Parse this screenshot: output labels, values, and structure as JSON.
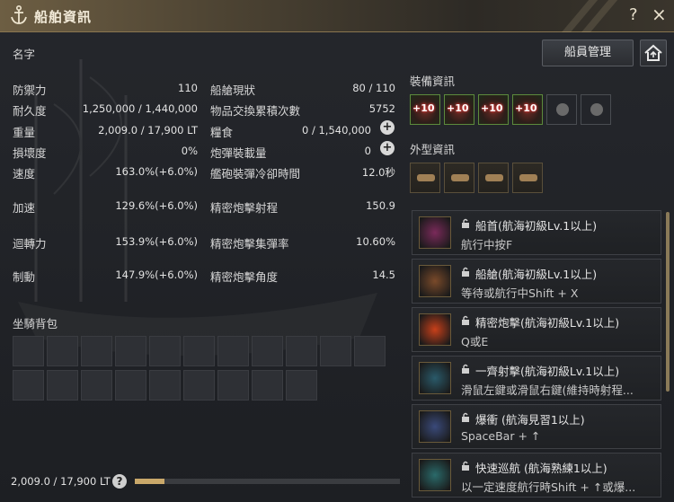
{
  "window": {
    "title": "船舶資訊",
    "help": "?",
    "close": "×"
  },
  "ship_name_label": "名字",
  "stats_left": [
    {
      "label": "防禦力",
      "value": "110"
    },
    {
      "label": "耐久度",
      "value": "1,250,000 / 1,440,000"
    },
    {
      "label": "重量",
      "value": "2,009.0 / 17,900 LT"
    },
    {
      "label": "損壞度",
      "value": "0%"
    },
    {
      "label": "速度",
      "value": "163.0%(+6.0%)"
    },
    {
      "label": "加速",
      "value": "129.6%(+6.0%)"
    },
    {
      "label": "迴轉力",
      "value": "153.9%(+6.0%)"
    },
    {
      "label": "制動",
      "value": "147.9%(+6.0%)"
    }
  ],
  "stats_right": [
    {
      "label": "船艙現狀",
      "value": "80 / 110"
    },
    {
      "label": "物品交換累積次數",
      "value": "5752"
    },
    {
      "label": "糧食",
      "value": "0 / 1,540,000"
    },
    {
      "label": "炮彈裝載量",
      "value": "0"
    },
    {
      "label": "艦砲裝彈冷卻時間",
      "value": "12.0秒"
    },
    {
      "label": "精密炮擊射程",
      "value": "150.9"
    },
    {
      "label": "精密炮擊集彈率",
      "value": "10.60%"
    },
    {
      "label": "精密炮擊角度",
      "value": "14.5"
    }
  ],
  "crew_button": "船員管理",
  "equipment": {
    "title": "裝備資訊",
    "slots": [
      {
        "enhance": "+10",
        "icon": "ship-prow-icon"
      },
      {
        "enhance": "+10",
        "icon": "ship-plating-icon"
      },
      {
        "enhance": "+10",
        "icon": "ship-cannon-icon"
      },
      {
        "enhance": "+10",
        "icon": "ship-sail-icon"
      },
      {
        "enhance": "",
        "icon": "crew-emblem-icon"
      },
      {
        "enhance": "",
        "icon": "fishing-rod-icon"
      }
    ]
  },
  "appearance": {
    "title": "外型資訊",
    "slots": 4
  },
  "skills": [
    {
      "name": "船首(航海初級Lv.1以上)",
      "desc": "航行中按F",
      "color": "#7a2a5a"
    },
    {
      "name": "船艙(航海初級Lv.1以上)",
      "desc": "等待或航行中Shift + X",
      "color": "#7a4a2a"
    },
    {
      "name": "精密炮擊(航海初級Lv.1以上)",
      "desc": "Q或E",
      "color": "#c8401a"
    },
    {
      "name": "一齊射擊(航海初級Lv.1以上)",
      "desc": "滑鼠左鍵或滑鼠右鍵(維持時射程...",
      "color": "#2a5a6a"
    },
    {
      "name": "爆衝 (航海見習1以上)",
      "desc": "SpaceBar + ↑",
      "color": "#3a4a7a"
    },
    {
      "name": "快速巡航 (航海熟練1以上)",
      "desc": "以一定速度航行時Shift + ↑或爆...",
      "color": "#2a6a6a"
    }
  ],
  "mount_bag": {
    "title": "坐騎背包",
    "row1_slots": 11,
    "row2_slots": 9
  },
  "weight": {
    "text": "2,009.0 / 17,900 LT",
    "ratio": 0.112
  },
  "colors": {
    "accent": "#c9a86a",
    "equip_border": "#5d8a3c"
  }
}
